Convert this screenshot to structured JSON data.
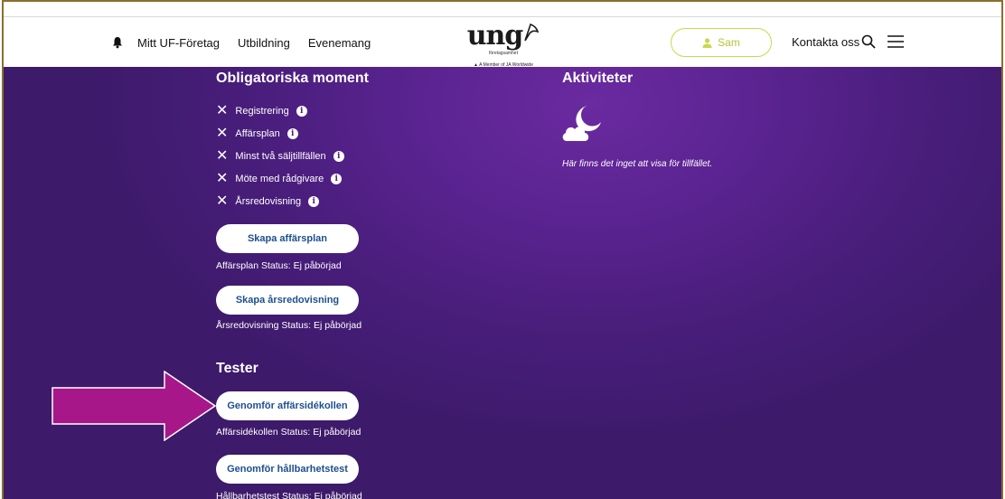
{
  "nav": {
    "bell_icon": "bell-icon",
    "links": [
      "Mitt UF-Företag",
      "Utbildning",
      "Evenemang"
    ],
    "logo_text": "ung",
    "logo_sub": "företagsamhet",
    "logo_member": "A Member of JA Worldwide",
    "user_label": "Sam",
    "contact_label": "Kontakta oss",
    "search_icon": "search-icon",
    "menu_icon": "hamburger-menu-icon",
    "accent_color": "#c9d84a"
  },
  "mandatory": {
    "title": "Obligatoriska moment",
    "items": [
      "Registrering",
      "Affärsplan",
      "Minst två säljtillfällen",
      "Möte med rådgivare",
      "Årsredovisning"
    ]
  },
  "actions": {
    "business_plan_button": "Skapa affärsplan",
    "business_plan_status": "Affärsplan Status: Ej påbörjad",
    "annual_report_button": "Skapa årsredovisning",
    "annual_report_status": "Årsredovisning Status: Ej påbörjad"
  },
  "tests": {
    "title": "Tester",
    "business_check_button": "Genomför affärsidékollen",
    "business_check_status": "Affärsidékollen Status: Ej påbörjad",
    "sustainability_button": "Genomför hållbarhetstest",
    "sustainability_status": "Hållbarhetstest Status: Ej påbörjad"
  },
  "activities": {
    "title": "Aktiviteter",
    "icon": "moon-cloud-icon",
    "empty_message": "Här finns det inget att visa för tillfället."
  },
  "colors": {
    "background_purple": "#4a1f80",
    "button_text": "#1c4f8f",
    "arrow": "#a8178a"
  }
}
